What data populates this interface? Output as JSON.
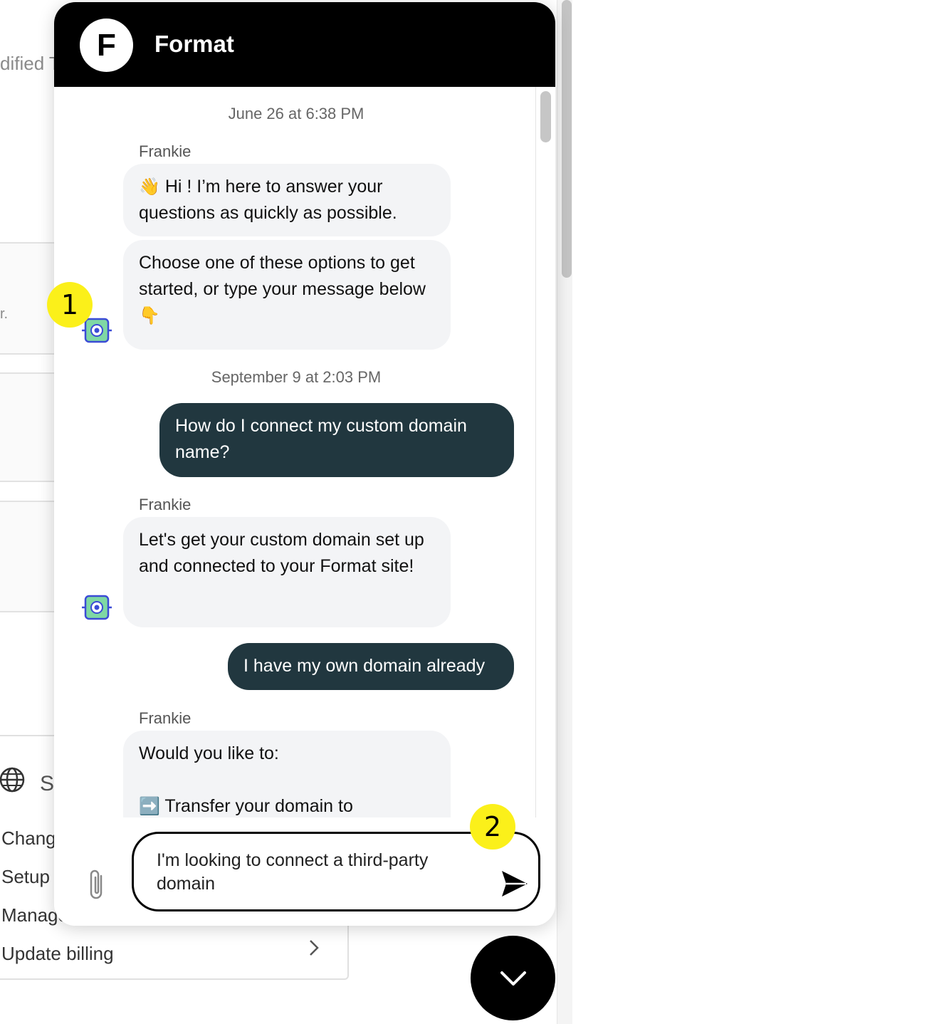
{
  "background": {
    "modified_fragment": "dified T",
    "small_fragment": "r.",
    "globe_heading_fragment": "S",
    "menu_items": [
      "Change",
      "Setup y",
      "Manage",
      "Update billing"
    ]
  },
  "chat": {
    "brand": {
      "logo_letter": "F",
      "title": "Format"
    },
    "timestamps": [
      "June 26 at 6:38 PM",
      "September 9 at 2:03 PM"
    ],
    "sender_name": "Frankie",
    "messages": {
      "greeting_emoji": "👋",
      "greeting": "Hi ! I’m here to answer your questions as quickly as possible.",
      "options_prompt": "Choose one of these options to get started, or type your message below",
      "options_emoji": "👇",
      "user_question": "How do I connect my custom domain name?",
      "bot_domain_reply": "Let's get your custom domain set up and connected to your Format site!",
      "user_choice": "I have my own domain already",
      "bot_followup_line1": "Would you like to:",
      "bot_followup_arrow": "➡️",
      "bot_followup_line2": "Transfer your domain to"
    },
    "composer": {
      "input_value": "I'm looking to connect a third-party domain"
    }
  },
  "annotations": {
    "marker_1": "1",
    "marker_2": "2"
  },
  "colors": {
    "header": "#000000",
    "user_bubble": "#21373f",
    "bot_bubble": "#f3f4f6",
    "marker": "#fbf01a"
  }
}
